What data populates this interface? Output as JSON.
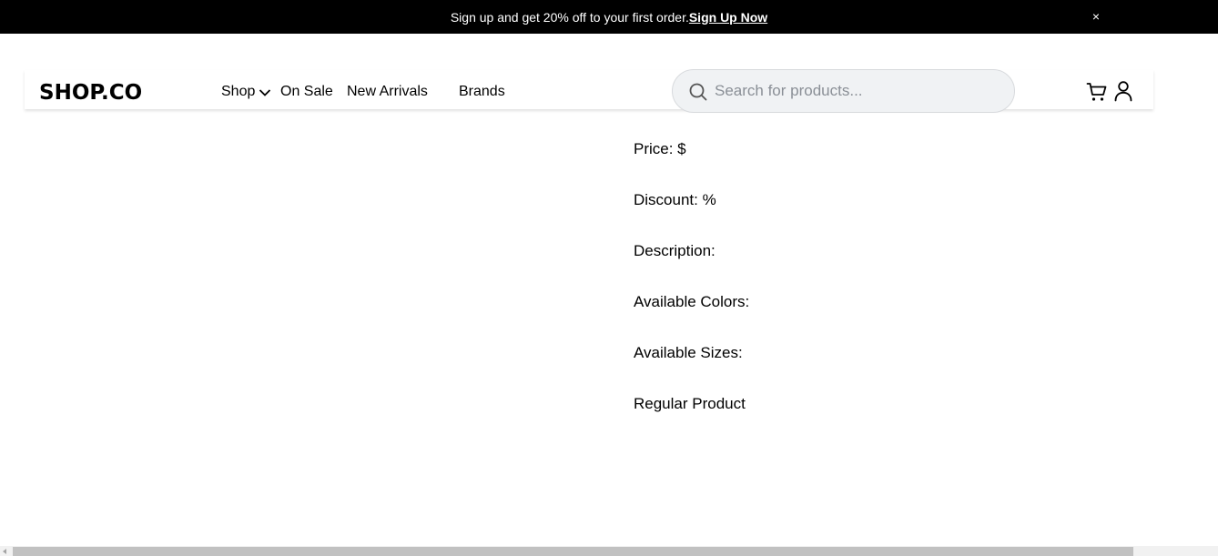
{
  "promo": {
    "text": "Sign up and get 20% off to your first order.",
    "link": "Sign Up Now",
    "close": "×"
  },
  "header": {
    "logo": "SHOP.CO",
    "nav": {
      "shop": "Shop",
      "on_sale": "On Sale",
      "new_arrivals": "New Arrivals",
      "brands": "Brands"
    },
    "search": {
      "placeholder": "Search for products...",
      "value": ""
    },
    "icons": [
      "chevron-down-icon",
      "search-icon",
      "cart-icon",
      "user-icon"
    ]
  },
  "product": {
    "price": "Price: $",
    "discount": "Discount: %",
    "description": "Description:",
    "colors": "Available Colors:",
    "sizes": "Available Sizes:",
    "type": "Regular Product"
  },
  "colors": {
    "promo_bg": "#000000",
    "search_bg": "#f0f2f4",
    "text": "#000000"
  }
}
